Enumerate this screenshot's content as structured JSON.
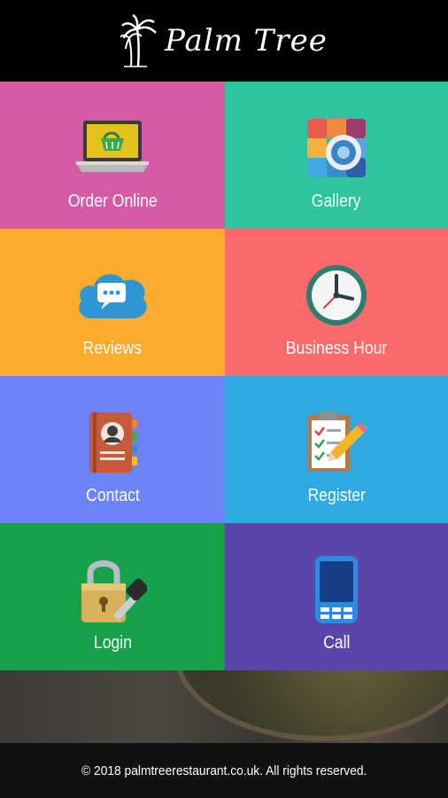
{
  "header": {
    "logo_text": "Palm Tree",
    "logo_icon": "palm-tree-icon"
  },
  "tiles": [
    {
      "id": "order-online",
      "label": "Order Online",
      "color": "#d65ba7",
      "icon": "laptop-basket-icon"
    },
    {
      "id": "gallery",
      "label": "Gallery",
      "color": "#2fc4a0",
      "icon": "gallery-camera-icon"
    },
    {
      "id": "reviews",
      "label": "Reviews",
      "color": "#fcab2d",
      "icon": "chat-cloud-icon"
    },
    {
      "id": "business-hour",
      "label": "Business Hour",
      "color": "#fb6a6a",
      "icon": "clock-icon"
    },
    {
      "id": "contact",
      "label": "Contact",
      "color": "#6c83f7",
      "icon": "address-book-icon"
    },
    {
      "id": "register",
      "label": "Register",
      "color": "#30a8e0",
      "icon": "clipboard-pencil-icon"
    },
    {
      "id": "login",
      "label": "Login",
      "color": "#16a14a",
      "icon": "padlock-key-icon"
    },
    {
      "id": "call",
      "label": "Call",
      "color": "#5b45a8",
      "icon": "phone-icon"
    }
  ],
  "footer": {
    "copyright": "© 2018 palmtreerestaurant.co.uk. All rights reserved."
  }
}
